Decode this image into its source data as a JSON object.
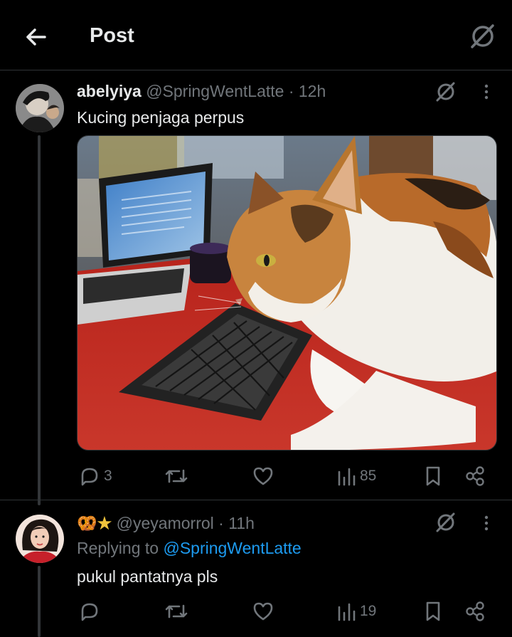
{
  "header": {
    "title": "Post"
  },
  "tweet": {
    "display_name": "abelyiya",
    "handle": "@SpringWentLatte",
    "time": "· 12h",
    "text": "Kucing penjaga perpus",
    "image_alt": "Calico cat lying on a red desk next to a keyboard and laptop",
    "stats": {
      "replies": "3",
      "retweets": "",
      "likes": "",
      "views": "85"
    }
  },
  "reply": {
    "display_name": "🥨★",
    "handle": "@yeyamorrol",
    "time": "· 11h",
    "replying_prefix": "Replying to",
    "replying_handle": "@SpringWentLatte",
    "text": "pukul pantatnya pls",
    "stats": {
      "replies": "",
      "retweets": "",
      "likes": "",
      "views": "19"
    }
  },
  "colors": {
    "background": "#000000",
    "text": "#e7e9ea",
    "muted": "#71767b",
    "link": "#1d9bf0",
    "divider": "#2f3336"
  }
}
